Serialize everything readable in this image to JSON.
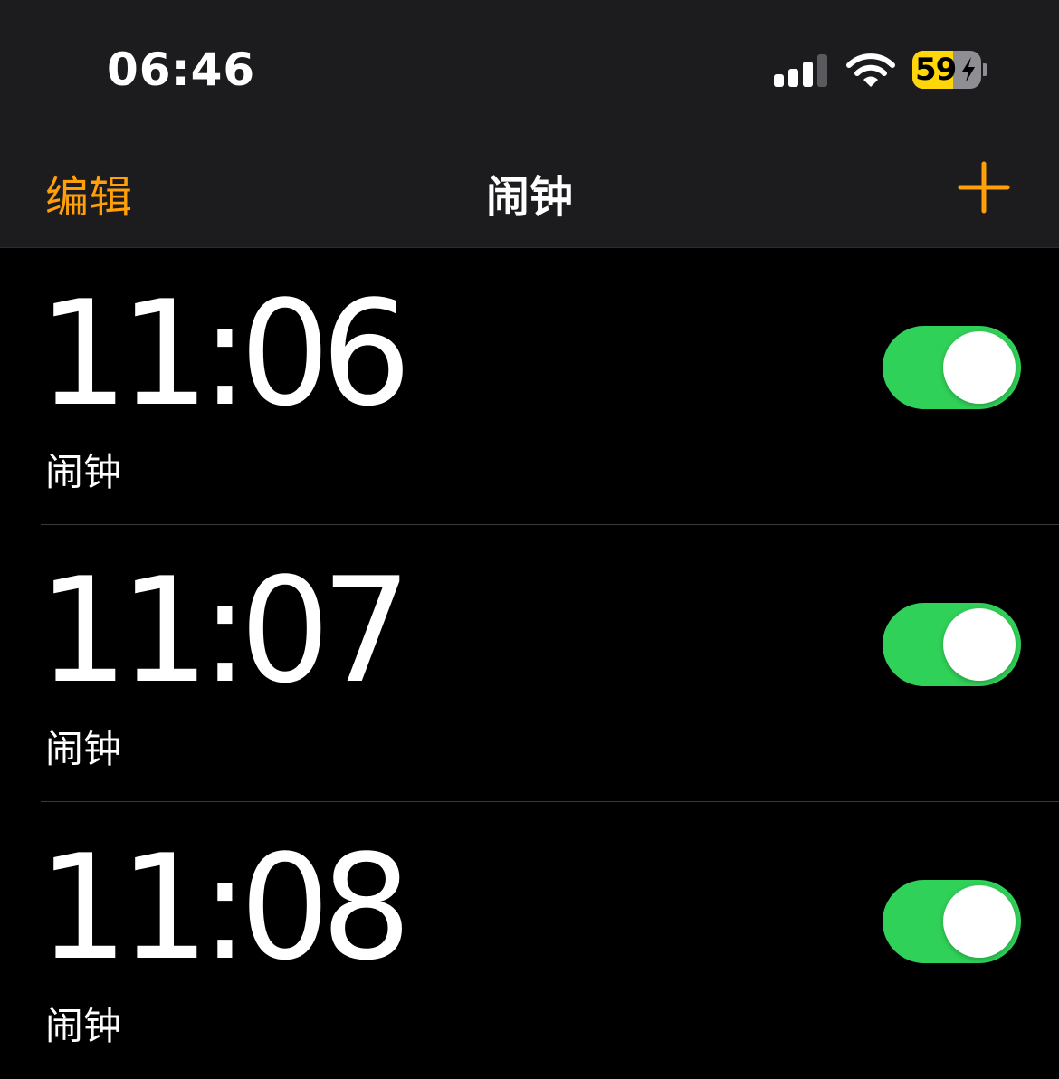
{
  "status_bar": {
    "time": "06:46",
    "signal_icon": "cellular-signal-icon",
    "wifi_icon": "wifi-icon",
    "battery_percent": "59",
    "battery_level": 0.59,
    "battery_charging": true,
    "battery_color": "#ffd60a"
  },
  "nav": {
    "edit_label": "编辑",
    "title": "闹钟",
    "add_icon": "plus-icon",
    "accent_color": "#ff9f0a"
  },
  "alarms": [
    {
      "time": "11:06",
      "label": "闹钟",
      "enabled": true
    },
    {
      "time": "11:07",
      "label": "闹钟",
      "enabled": true
    },
    {
      "time": "11:08",
      "label": "闹钟",
      "enabled": true
    }
  ],
  "toggle_on_color": "#30d158"
}
